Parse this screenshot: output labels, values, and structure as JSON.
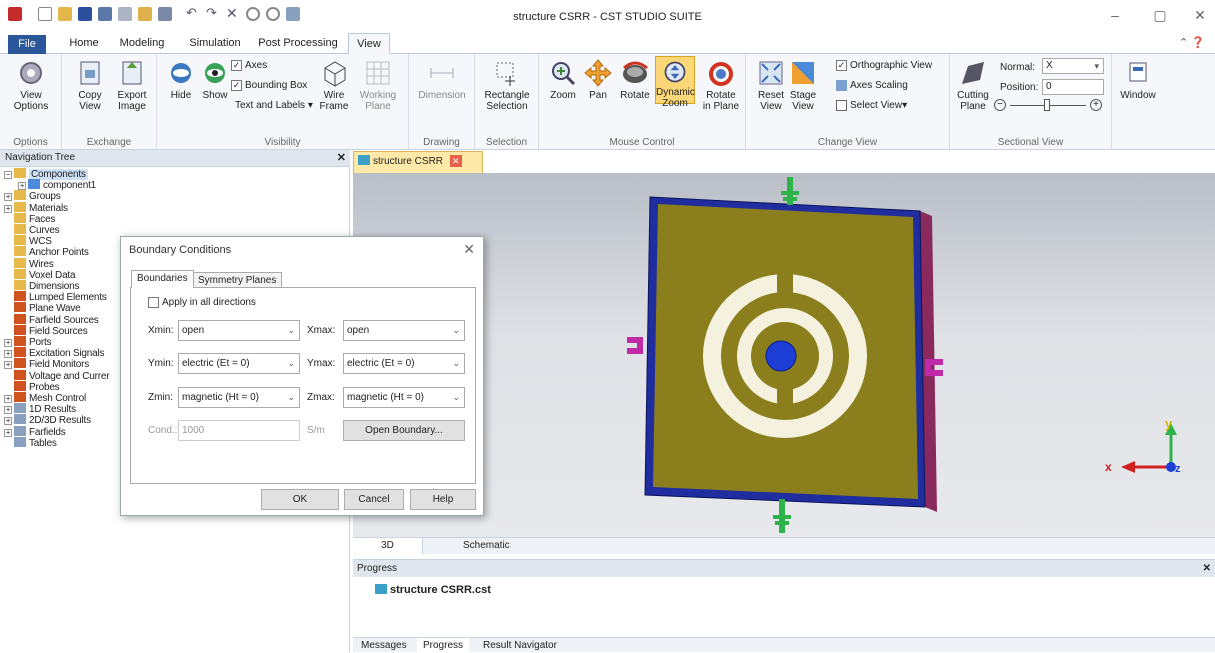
{
  "window": {
    "title": "structure CSRR - CST STUDIO SUITE"
  },
  "ribbon_tabs": [
    "File",
    "Home",
    "Modeling",
    "Simulation",
    "Post Processing",
    "View"
  ],
  "ribbon": {
    "options": {
      "group": "Options",
      "view_options": "View Options"
    },
    "exchange": {
      "group": "Exchange",
      "copy_view": "Copy View",
      "export_image": "Export Image"
    },
    "visibility": {
      "group": "Visibility",
      "hide": "Hide",
      "show": "Show",
      "axes": "Axes",
      "bounding_box": "Bounding Box",
      "text_labels": "Text and Labels ▾",
      "wire_frame": "Wire Frame",
      "working_plane": "Working Plane"
    },
    "drawing": {
      "group": "Drawing",
      "dimension": "Dimension"
    },
    "selection": {
      "group": "Selection",
      "rectangle_selection": "Rectangle Selection"
    },
    "mouse_control": {
      "group": "Mouse Control",
      "zoom": "Zoom",
      "pan": "Pan",
      "rotate": "Rotate",
      "dynamic_zoom": "Dynamic Zoom",
      "rotate_in_plane": "Rotate in Plane"
    },
    "change_view": {
      "group": "Change View",
      "reset_view": "Reset View",
      "stage_view": "Stage View",
      "orthographic": "Orthographic View",
      "axes_scaling": "Axes Scaling",
      "select_view": "Select View▾"
    },
    "sectional": {
      "group": "Sectional View",
      "cutting_plane": "Cutting Plane",
      "normal_label": "Normal:",
      "normal_value": "X",
      "position_label": "Position:",
      "position_value": "0"
    },
    "window": {
      "label": "Window"
    }
  },
  "nav": {
    "title": "Navigation Tree",
    "items": [
      "Components",
      "component1",
      "Groups",
      "Materials",
      "Faces",
      "Curves",
      "WCS",
      "Anchor Points",
      "Wires",
      "Voxel Data",
      "Dimensions",
      "Lumped Elements",
      "Plane Wave",
      "Farfield Sources",
      "Field Sources",
      "Ports",
      "Excitation Signals",
      "Field Monitors",
      "Voltage and Currer",
      "Probes",
      "Mesh Control",
      "1D Results",
      "2D/3D Results",
      "Farfields",
      "Tables"
    ]
  },
  "doc_tab": "structure CSRR",
  "view_tabs": [
    "3D",
    "Schematic"
  ],
  "progress": {
    "title": "Progress",
    "file": "structure CSRR.cst"
  },
  "bottom_tabs": [
    "Messages",
    "Progress",
    "Result Navigator"
  ],
  "axes": {
    "x": "x",
    "y": "y",
    "z": "z"
  },
  "dialog": {
    "title": "Boundary Conditions",
    "tabs": [
      "Boundaries",
      "Symmetry Planes"
    ],
    "apply_all": "Apply in all directions",
    "xmin_label": "Xmin:",
    "xmin": "open",
    "xmax_label": "Xmax:",
    "xmax": "open",
    "ymin_label": "Ymin:",
    "ymin": "electric (Et = 0)",
    "ymax_label": "Ymax:",
    "ymax": "electric (Et = 0)",
    "zmin_label": "Zmin:",
    "zmin": "magnetic (Ht = 0)",
    "zmax_label": "Zmax:",
    "zmax": "magnetic (Ht = 0)",
    "cond_label": "Cond.:",
    "cond_value": "1000",
    "cond_unit": "S/m",
    "open_boundary": "Open Boundary...",
    "ok": "OK",
    "cancel": "Cancel",
    "help": "Help"
  },
  "colors": {
    "substrate": "#8a7f1c",
    "frame": "#1f2d9e",
    "ring": "#f4f1de",
    "patch": "#1c3dd6",
    "port": "#c02aa8",
    "feed": "#2db34a",
    "ribbon_bg": "#f5f7fa",
    "file_tab": "#2b579a"
  }
}
